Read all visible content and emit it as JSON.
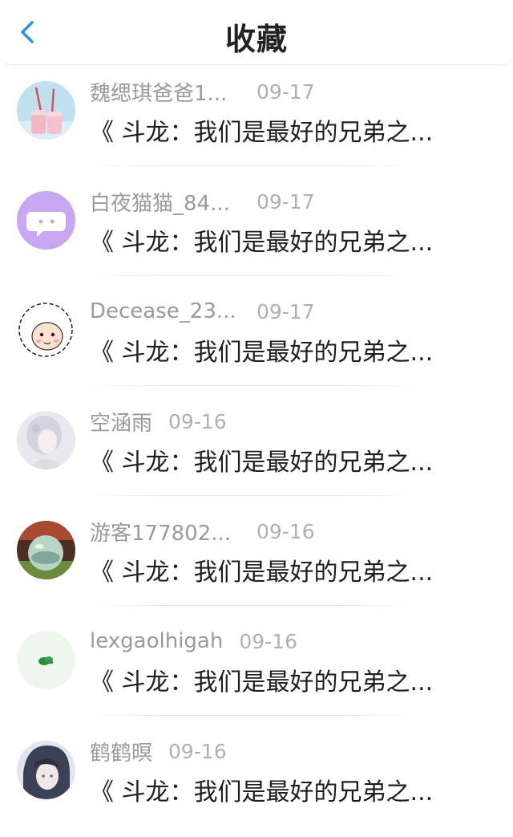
{
  "header": {
    "title": "收藏"
  },
  "colors": {
    "accent": "#2f8fe8",
    "text_primary": "#1e1e1e",
    "text_secondary": "#9a9a9a"
  },
  "favorites": [
    {
      "username": "魏缌琪爸爸1...",
      "date": "09-17",
      "title": "《 斗龙：我们是最好的兄弟之...",
      "avatar": "milk-drinks-avatar"
    },
    {
      "username": "白夜猫猫_84...",
      "date": "09-17",
      "title": "《 斗龙：我们是最好的兄弟之...",
      "avatar": "chat-bubble-avatar"
    },
    {
      "username": "Decease_23...",
      "date": "09-17",
      "title": "《 斗龙：我们是最好的兄弟之...",
      "avatar": "cartoon-sheep-avatar"
    },
    {
      "username": "空涵雨",
      "date": "09-16",
      "title": "《 斗龙：我们是最好的兄弟之...",
      "avatar": "girl-portrait-avatar"
    },
    {
      "username": "游客177802...",
      "date": "09-16",
      "title": "《 斗龙：我们是最好的兄弟之...",
      "avatar": "crystal-ball-avatar"
    },
    {
      "username": "lexgaolhigah",
      "date": "09-16",
      "title": "《 斗龙：我们是最好的兄弟之...",
      "avatar": "green-plant-avatar"
    },
    {
      "username": "鹤鹤暝",
      "date": "09-16",
      "title": "《 斗龙：我们是最好的兄弟之...",
      "avatar": "anime-character-avatar"
    }
  ]
}
